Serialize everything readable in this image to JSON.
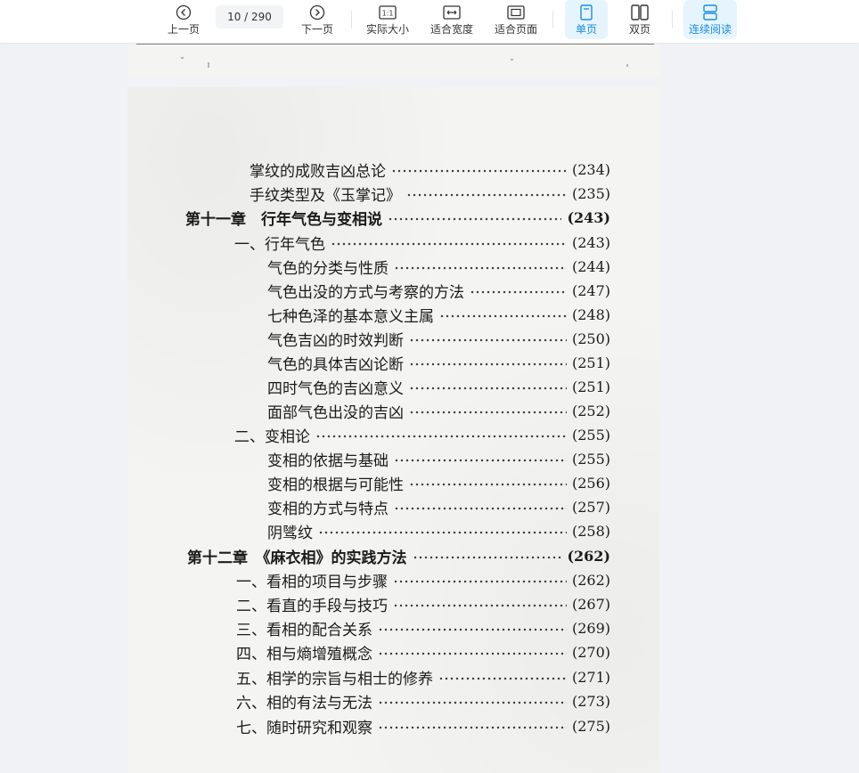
{
  "toolbar": {
    "prev_label": "上一页",
    "page_indicator": "10 / 290",
    "next_label": "下一页",
    "actual_size_label": "实际大小",
    "actual_size_icon_text": "1:1",
    "fit_width_label": "适合宽度",
    "fit_page_label": "适合页面",
    "single_page_label": "单页",
    "double_page_label": "双页",
    "continuous_label": "连续阅读",
    "accent_color": "#1a8ee0",
    "active_modes": [
      "单页",
      "连续阅读"
    ]
  },
  "toc": [
    {
      "title": "掌纹的成败吉凶总论",
      "page": "(234)",
      "bold": false
    },
    {
      "title": "手纹类型及《玉掌记》",
      "page": "(235)",
      "bold": false
    },
    {
      "title": "第十一章　行年气色与变相说",
      "page": "(243)",
      "bold": true
    },
    {
      "title": "一、行年气色",
      "page": "(243)",
      "bold": false
    },
    {
      "title": "气色的分类与性质",
      "page": "(244)",
      "bold": false
    },
    {
      "title": "气色出没的方式与考察的方法",
      "page": "(247)",
      "bold": false
    },
    {
      "title": "七种色泽的基本意义主属",
      "page": "(248)",
      "bold": false
    },
    {
      "title": "气色吉凶的时效判断",
      "page": "(250)",
      "bold": false
    },
    {
      "title": "气色的具体吉凶论断",
      "page": "(251)",
      "bold": false
    },
    {
      "title": "四时气色的吉凶意义",
      "page": "(251)",
      "bold": false
    },
    {
      "title": "面部气色出没的吉凶",
      "page": "(252)",
      "bold": false
    },
    {
      "title": "二、变相论",
      "page": "(255)",
      "bold": false
    },
    {
      "title": "变相的依据与基础",
      "page": "(255)",
      "bold": false
    },
    {
      "title": "变相的根据与可能性",
      "page": "(256)",
      "bold": false
    },
    {
      "title": "变相的方式与特点",
      "page": "(257)",
      "bold": false
    },
    {
      "title": "阴骘纹",
      "page": "(258)",
      "bold": false
    },
    {
      "title": "第十二章　《麻衣相》的实践方法",
      "page": "(262)",
      "bold": true
    },
    {
      "title": "一、看相的项目与步骤",
      "page": "(262)",
      "bold": false
    },
    {
      "title": "二、看直的手段与技巧",
      "page": "(267)",
      "bold": false
    },
    {
      "title": "三、看相的配合关系",
      "page": "(269)",
      "bold": false
    },
    {
      "title": "四、相与熵增殖概念",
      "page": "(270)",
      "bold": false
    },
    {
      "title": "五、相学的宗旨与相士的修养",
      "page": "(271)",
      "bold": false
    },
    {
      "title": "六、相的有法与无法",
      "page": "(273)",
      "bold": false
    },
    {
      "title": "七、随时研究和观察",
      "page": "(275)",
      "bold": false
    }
  ]
}
